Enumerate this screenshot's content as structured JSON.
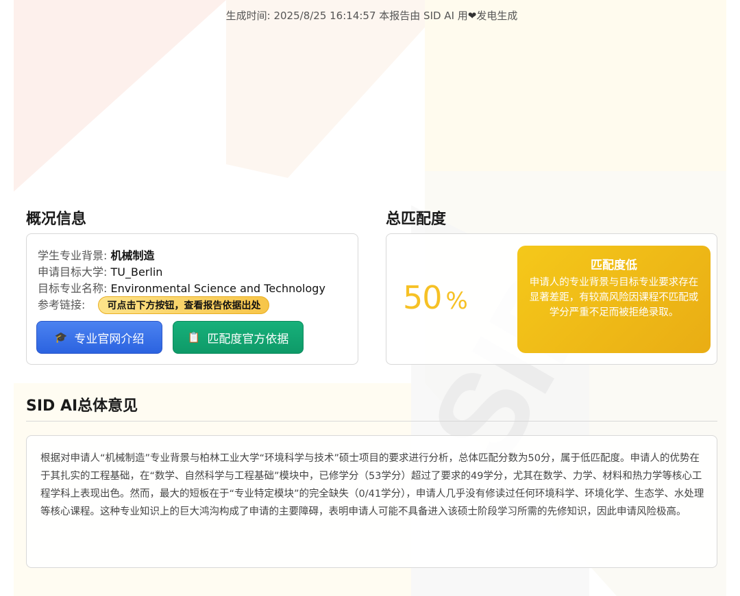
{
  "footer": {
    "generated_prefix": "生成时间: 2025/8/25 16:14:57 本报告由 SID AI 用",
    "heart": "❤",
    "generated_suffix": "发电生成"
  },
  "overview": {
    "title": "概况信息",
    "background_label": "学生专业背景: ",
    "background_value": "机械制造",
    "university_label": "申请目标大学: ",
    "university_value": "TU_Berlin",
    "program_label": "目标专业名称: ",
    "program_value": "Environmental Science and Technology",
    "reference_label": "参考链接: ",
    "reference_hint": "可点击下方按钮，查看报告依据出处",
    "intro_button": "专业官网介绍",
    "basis_button": "匹配度官方依据",
    "intro_icon": "graduation-cap-icon",
    "basis_icon": "clipboard-icon"
  },
  "match": {
    "title": "总匹配度",
    "value": "50",
    "unit": "%",
    "level": "匹配度低",
    "description": "申请人的专业背景与目标专业要求存在显著差距，有较高风险因课程不匹配或学分严重不足而被拒绝录取。",
    "color": "#f6c125"
  },
  "opinion": {
    "title": "SID AI总体意见",
    "text": "根据对申请人“机械制造”专业背景与柏林工业大学“环境科学与技术”硕士项目的要求进行分析，总体匹配分数为50分，属于低匹配度。申请人的优势在于其扎实的工程基础，在“数学、自然科学与工程基础”模块中，已修学分（53学分）超过了要求的49学分，尤其在数学、力学、材料和热力学等核心工程学科上表现出色。然而，最大的短板在于“专业特定模块”的完全缺失（0/41学分），申请人几乎没有修读过任何环境科学、环境化学、生态学、水处理等核心课程。这种专业知识上的巨大鸿沟构成了申请的主要障碍，表明申请人可能不具备进入该硕士阶段学习所需的先修知识，因此申请风险极高。"
  },
  "colors": {
    "accent_yellow": "#f6c125",
    "button_blue": "#2b63e0",
    "button_green": "#0e9a68"
  }
}
